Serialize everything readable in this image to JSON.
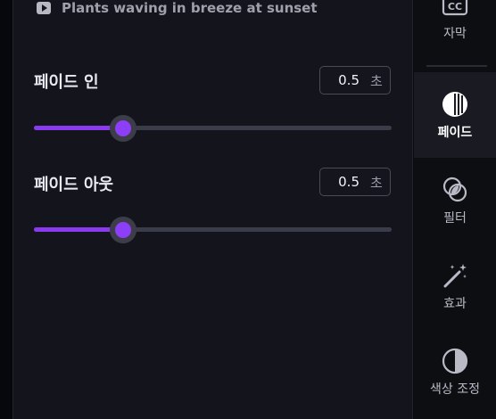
{
  "clip": {
    "title": "Plants waving in breeze at sunset"
  },
  "fade_in": {
    "label": "페이드 인",
    "value": "0.5",
    "unit": "초",
    "slider_fraction": 0.25
  },
  "fade_out": {
    "label": "페이드 아웃",
    "value": "0.5",
    "unit": "초",
    "slider_fraction": 0.25
  },
  "sidebar": {
    "items": [
      {
        "label": "자막",
        "icon": "closed-captions-icon"
      },
      {
        "label": "페이드",
        "icon": "fade-icon",
        "active": true
      },
      {
        "label": "필터",
        "icon": "filter-icon"
      },
      {
        "label": "효과",
        "icon": "magic-wand-icon"
      },
      {
        "label": "색상 조정",
        "icon": "color-adjust-icon"
      }
    ]
  },
  "colors": {
    "accent": "#8d3ff7",
    "panel": "#14151c",
    "sidebar": "#0d0e12"
  }
}
